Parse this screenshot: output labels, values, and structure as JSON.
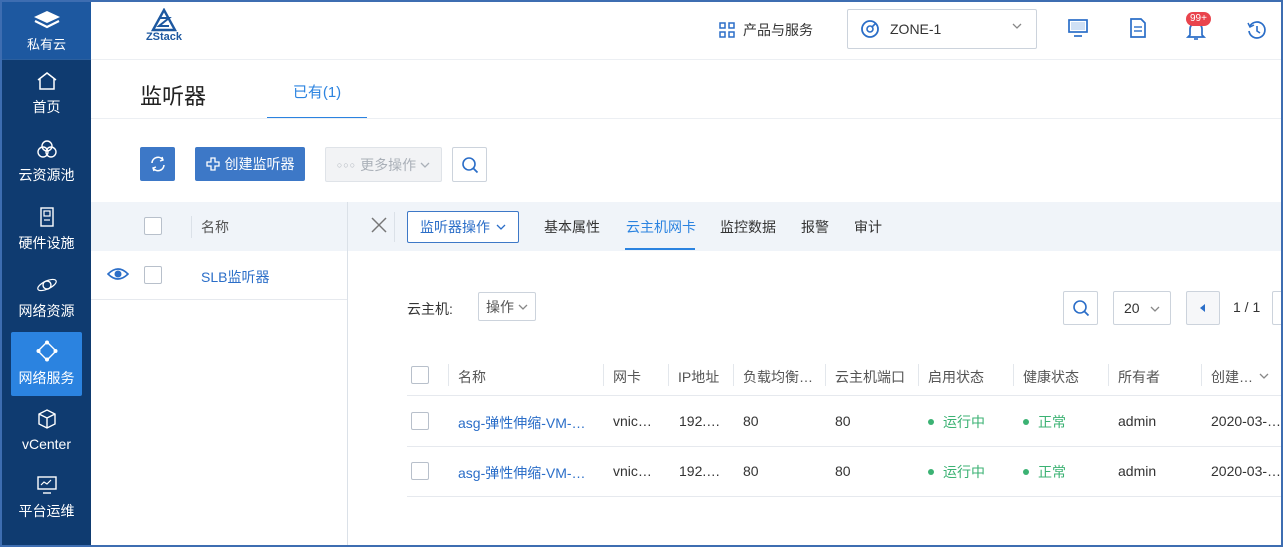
{
  "sidebar": {
    "brand_label": "私有云",
    "items": [
      {
        "label": "首页",
        "icon": "home-icon"
      },
      {
        "label": "云资源池",
        "icon": "resource-pool-icon"
      },
      {
        "label": "硬件设施",
        "icon": "hardware-icon"
      },
      {
        "label": "网络资源",
        "icon": "network-resource-icon"
      },
      {
        "label": "网络服务",
        "icon": "network-service-icon",
        "active": true
      },
      {
        "label": "vCenter",
        "icon": "cube-icon"
      },
      {
        "label": "平台运维",
        "icon": "monitor-icon"
      }
    ]
  },
  "header": {
    "logo_text": "ZStack",
    "products_label": "产品与服务",
    "zone": "ZONE-1",
    "notification_badge": "99+"
  },
  "page": {
    "title": "监听器",
    "tab_existing": "已有(1)"
  },
  "toolbar": {
    "create_label": "创建监听器",
    "more_label": "更多操作"
  },
  "list": {
    "header_name": "名称",
    "rows": [
      {
        "name": "SLB监听器"
      }
    ]
  },
  "detail": {
    "actions_label": "监听器操作",
    "tabs": [
      "基本属性",
      "云主机网卡",
      "监控数据",
      "报警",
      "审计"
    ],
    "active_tab": "云主机网卡"
  },
  "vm_section": {
    "label": "云主机:",
    "op_label": "操作",
    "page_size": "20",
    "page_info": "1 / 1"
  },
  "table": {
    "columns": [
      "名称",
      "网卡",
      "IP地址",
      "负载均衡…",
      "云主机端口",
      "启用状态",
      "健康状态",
      "所有者",
      "创建…"
    ],
    "rows": [
      {
        "name": "asg-弹性伸缩-VM-…",
        "nic": "vnic…",
        "ip": "192.…",
        "lb_port": "80",
        "vm_port": "80",
        "state": "运行中",
        "health": "正常",
        "owner": "admin",
        "created": "2020-03-…"
      },
      {
        "name": "asg-弹性伸缩-VM-…",
        "nic": "vnic…",
        "ip": "192.…",
        "lb_port": "80",
        "vm_port": "80",
        "state": "运行中",
        "health": "正常",
        "owner": "admin",
        "created": "2020-03-…"
      }
    ]
  },
  "colors": {
    "sidebar_bg": "#0f3b70",
    "accent": "#2b83e0",
    "button_blue": "#3d78c7",
    "status_green": "#3bb273",
    "badge_red": "#e9444d"
  }
}
